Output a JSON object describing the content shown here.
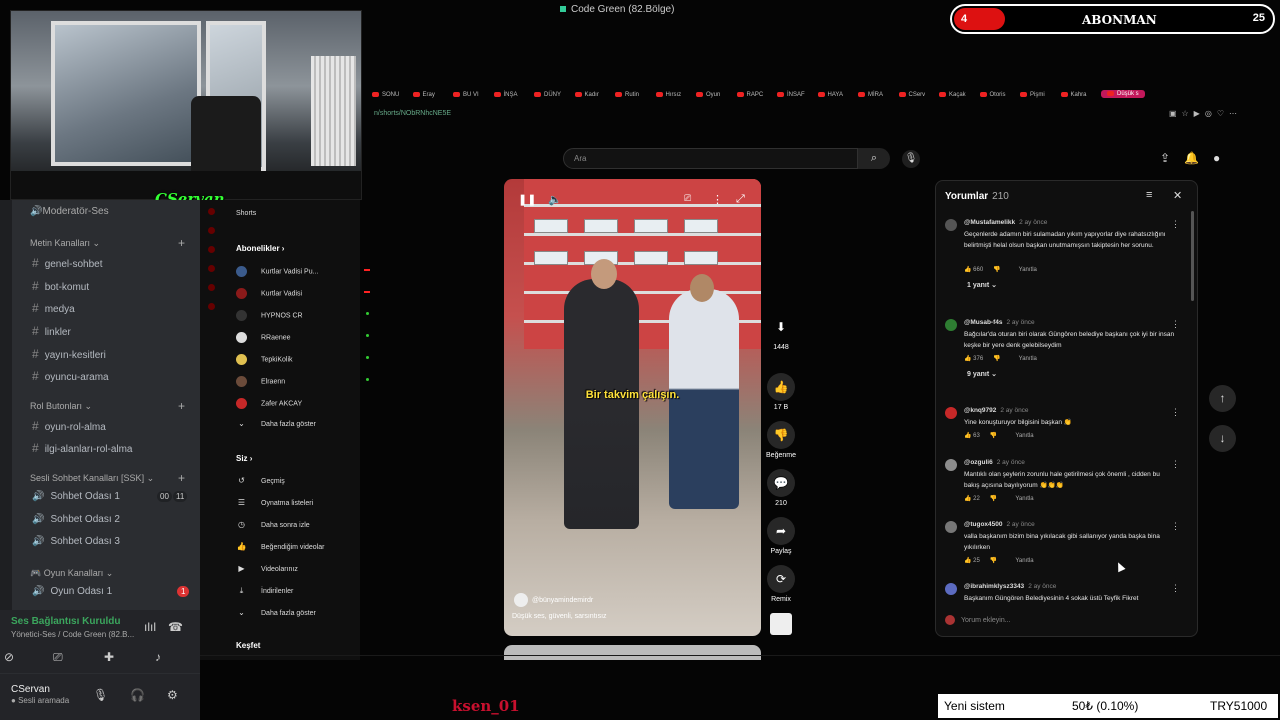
{
  "window": {
    "title": "Code Green (82.Bölge)"
  },
  "subscriber_goal": {
    "current": "4",
    "label": "ABONMAN",
    "target": "25",
    "progress": 0.16
  },
  "webcam": {
    "streamer_name": "CServan"
  },
  "discord": {
    "moderator_channel": "Moderatör-Ses",
    "text_category": "Metin Kanalları",
    "text_channels": [
      "genel-sohbet",
      "bot-komut",
      "medya",
      "linkler",
      "yayın-kesitleri",
      "oyuncu-arama"
    ],
    "role_category": "Rol Butonları",
    "role_channels": [
      "oyun-rol-alma",
      "ilgi-alanları-rol-alma"
    ],
    "voice_category": "Sesli Sohbet Kanalları [SSK]",
    "voice_channels": [
      {
        "name": "Sohbet Odası 1",
        "badge_a": "00",
        "badge_b": "11"
      },
      {
        "name": "Sohbet Odası 2"
      },
      {
        "name": "Sohbet Odası 3"
      }
    ],
    "game_category": "Oyun Kanalları",
    "game_channels": [
      {
        "name": "Oyun Odası 1",
        "badge": "1"
      }
    ],
    "voice_status": {
      "title": "Ses Bağlantısı Kuruldu",
      "subtitle": "Yönetici-Ses / Code Green (82.B..."
    },
    "user": {
      "name": "CServan",
      "status": "Sesli aramada"
    }
  },
  "browser": {
    "tabs": [
      "SONU",
      "Eray",
      "BU VI",
      "İNŞA",
      "DÜNY",
      "Kadır",
      "Rutin",
      "Hırsız",
      "Oyun",
      "RAPC",
      "İNSAF",
      "HAYA",
      "MİRA",
      "CServ",
      "Kaçak",
      "Otoris",
      "Pişmi",
      "Kahra",
      "Düşük"
    ],
    "active_tab": "Düşük s",
    "url": "n/shorts/NObRNhcNE5E"
  },
  "youtube": {
    "search_placeholder": "Ara",
    "sidebar": {
      "shorts": "Shorts",
      "subs_title": "Abonelikler",
      "subscriptions": [
        {
          "name": "Kurtlar Vadisi Pu...",
          "live": true,
          "color": "#3b5b8c"
        },
        {
          "name": "Kurtlar Vadisi",
          "live": true,
          "color": "#8b1a1a"
        },
        {
          "name": "HYPNOS CR",
          "dot": true,
          "color": "#333333"
        },
        {
          "name": "RRaenee",
          "dot": true,
          "color": "#dddddd"
        },
        {
          "name": "TepkiKolik",
          "dot": true,
          "color": "#e0c050"
        },
        {
          "name": "Elraenn",
          "dot": true,
          "color": "#6b4b3a"
        },
        {
          "name": "Zafer AKCAY",
          "color": "#c62828"
        }
      ],
      "subs_more": "Daha fazla göster",
      "you_title": "Siz",
      "you_items": [
        {
          "icon": "history-icon",
          "glyph": "↺",
          "label": "Geçmiş"
        },
        {
          "icon": "playlist-icon",
          "glyph": "☰",
          "label": "Oynatma listeleri"
        },
        {
          "icon": "clock-icon",
          "glyph": "◷",
          "label": "Daha sonra izle"
        },
        {
          "icon": "thumbs-up-icon",
          "glyph": "👍",
          "label": "Beğendiğim videolar"
        },
        {
          "icon": "video-icon",
          "glyph": "▶",
          "label": "Videolarınız"
        },
        {
          "icon": "download-icon",
          "glyph": "⤓",
          "label": "İndirilenler"
        },
        {
          "icon": "chevron-down-icon",
          "glyph": "⌄",
          "label": "Daha fazla göster"
        }
      ],
      "explore_title": "Keşfet"
    },
    "video": {
      "caption": "Bir takvim çalışın.",
      "author": "@bünyamindemirdr",
      "description": "Düşük ses, güvenli, sarsıntısız"
    },
    "actions": {
      "save_count": "1448",
      "likes": "17 B",
      "dislike_label": "Beğenme",
      "comments": "210",
      "share_label": "Paylaş",
      "remix_label": "Remix"
    },
    "comments": {
      "title": "Yorumlar",
      "count": "210",
      "items": [
        {
          "user": "@Mustafamelikk",
          "time": "2 ay önce",
          "text": "Geçenlerde adamın biri sulamadan yıkım yapıyorlar diye rahatsızlığını belirtmişti helal olsun başkan unutmamışsın takiptesin her sorunu.",
          "likes": "660",
          "reply": "Yanıtla",
          "replies": "1 yanıt",
          "color": "#555555"
        },
        {
          "user": "@Musab-f4s",
          "time": "2 ay önce",
          "text": "Bağcılar'da oturan biri olarak Güngören belediye başkanı çok iyi bir insan keşke bir yere denk gelebilseydim",
          "likes": "376",
          "reply": "Yanıtla",
          "replies": "9 yanıt",
          "color": "#2e7d32"
        },
        {
          "user": "@knq9792",
          "time": "2 ay önce",
          "text": "Yine konuşturuyor bilgisini başkan 👏",
          "likes": "63",
          "reply": "Yanıtla",
          "color": "#c62828"
        },
        {
          "user": "@ozguli6",
          "time": "2 ay önce",
          "text": "Mantıklı olan şeylerin zorunlu hale getirilmesi çok önemli , cidden bu bakış açısına bayılıyorum 👏👏👏",
          "likes": "22",
          "reply": "Yanıtla",
          "color": "#8d8d8d"
        },
        {
          "user": "@tugox4500",
          "time": "2 ay önce",
          "text": "valla başkanım bizim bina yıkılacak gibi sallanıyor yanda başka bina yıkılırken",
          "likes": "25",
          "reply": "Yanıtla",
          "color": "#777777"
        },
        {
          "user": "@ibrahimklysz3343",
          "time": "2 ay önce",
          "text": "Başkanım Güngören Belediyesinin 4 sokak üstü Teyfik Fikret",
          "color": "#5c6bc0"
        }
      ],
      "add_placeholder": "Yorum ekleyin..."
    }
  },
  "overlay": {
    "ticker_name": "ksen_01",
    "donation": {
      "label": "Yeni sistem",
      "amount": "50₺ (0.10%)",
      "goal": "TRY51000"
    }
  },
  "colors": {
    "accent_red": "#d11111",
    "discord_bg": "#2b2d31",
    "youtube_bg": "#0f0f0f",
    "cam_name": "#33ff33"
  }
}
